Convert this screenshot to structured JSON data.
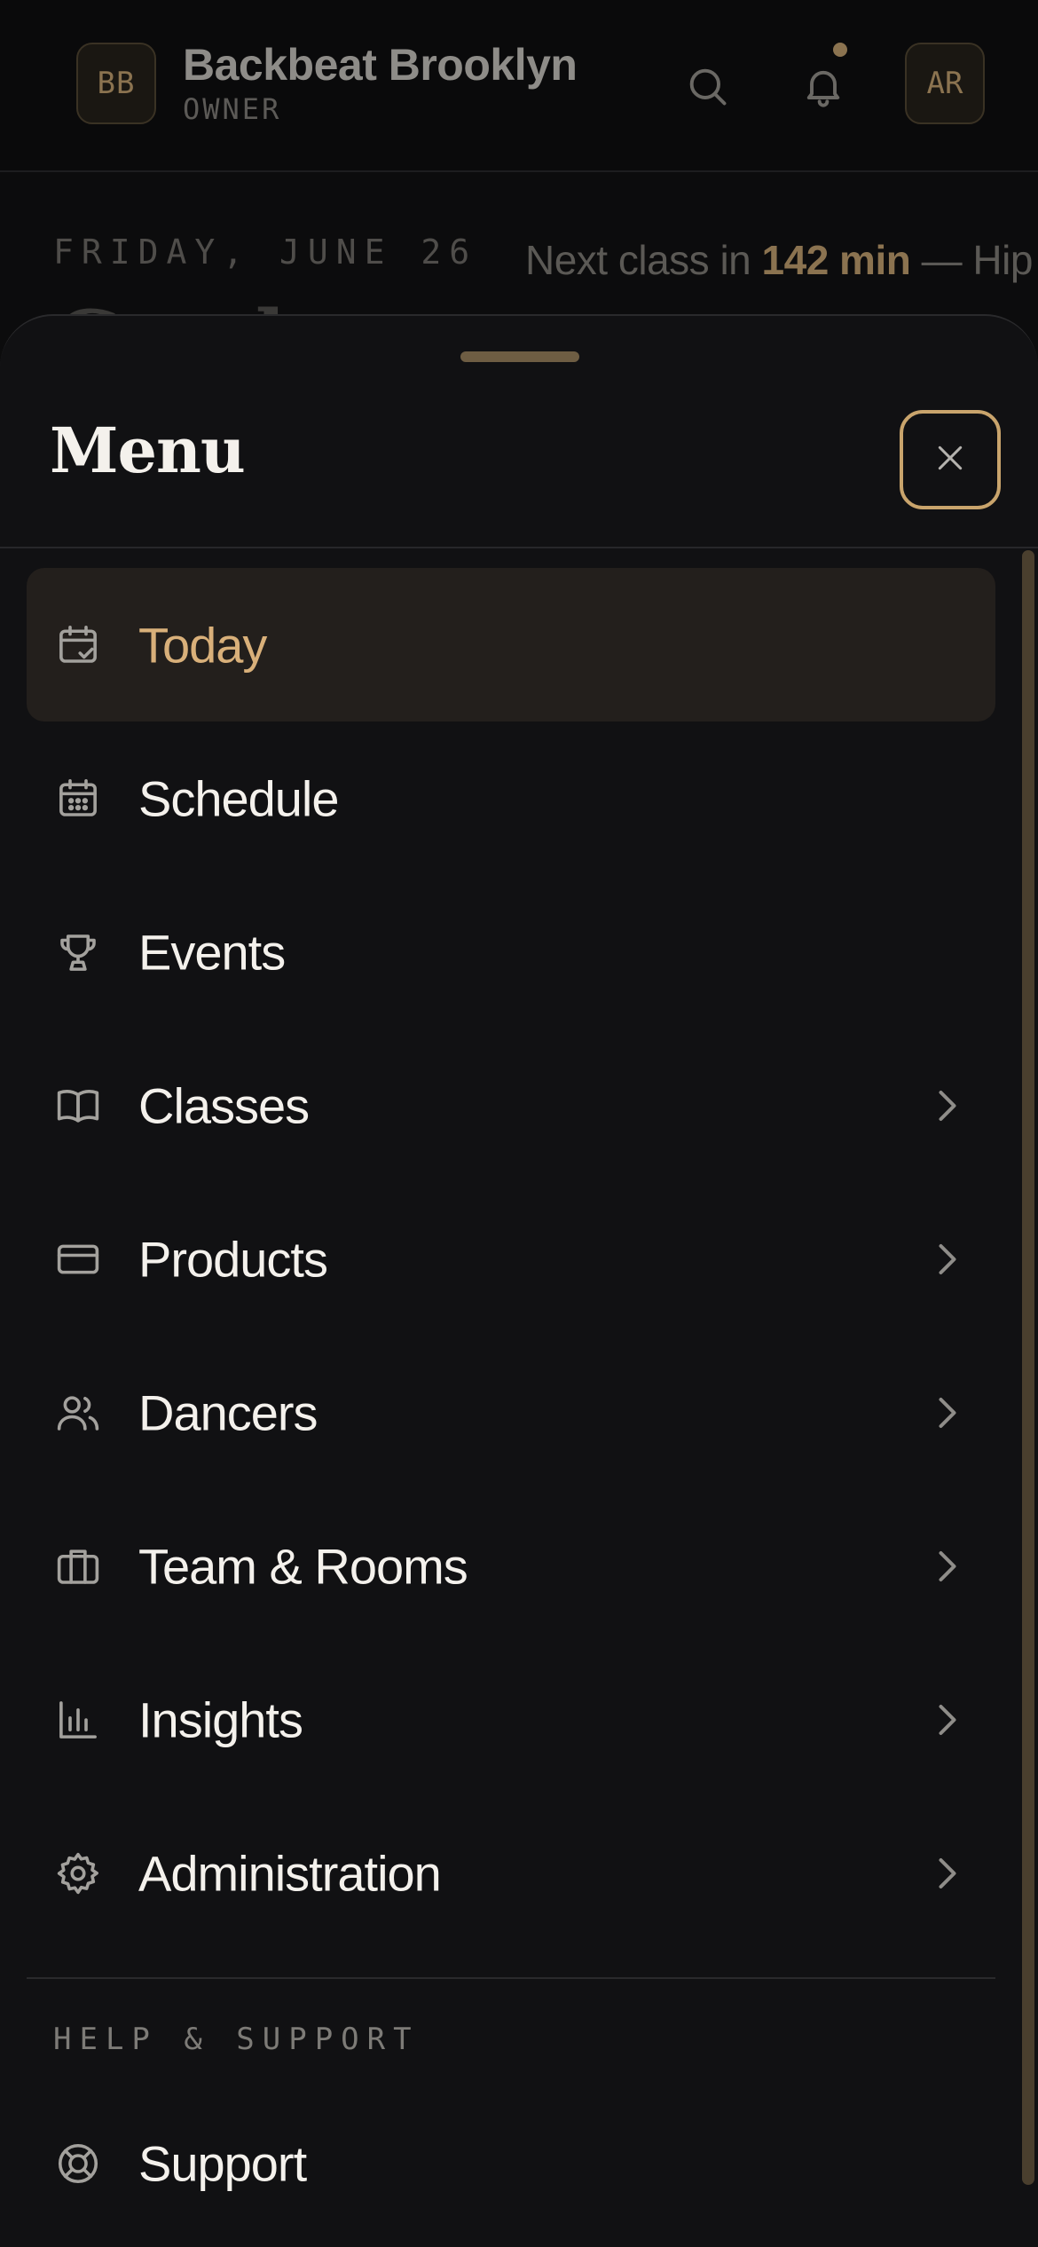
{
  "topbar": {
    "brand_initials": "BB",
    "brand_name": "Backbeat Brooklyn",
    "brand_role": "OWNER",
    "user_initials": "AR",
    "icons": [
      "search-icon",
      "bell-icon"
    ]
  },
  "background": {
    "date": "FRIDAY, JUNE 26",
    "next_class_prefix": "Next class in ",
    "next_class_time": "142 min",
    "next_class_suffix": " — Hip H",
    "heading_partial": "Good"
  },
  "sheet": {
    "title": "Menu",
    "close_icon": "close-icon",
    "items": [
      {
        "label": "Today",
        "icon": "calendar-check-icon",
        "active": true,
        "has_chevron": false
      },
      {
        "label": "Schedule",
        "icon": "calendar-grid-icon",
        "active": false,
        "has_chevron": false
      },
      {
        "label": "Events",
        "icon": "trophy-icon",
        "active": false,
        "has_chevron": false
      },
      {
        "label": "Classes",
        "icon": "book-icon",
        "active": false,
        "has_chevron": true
      },
      {
        "label": "Products",
        "icon": "credit-card-icon",
        "active": false,
        "has_chevron": true
      },
      {
        "label": "Dancers",
        "icon": "users-icon",
        "active": false,
        "has_chevron": true
      },
      {
        "label": "Team & Rooms",
        "icon": "briefcase-icon",
        "active": false,
        "has_chevron": true
      },
      {
        "label": "Insights",
        "icon": "bar-chart-icon",
        "active": false,
        "has_chevron": true
      },
      {
        "label": "Administration",
        "icon": "gear-icon",
        "active": false,
        "has_chevron": true
      }
    ],
    "help_section": {
      "label": "HELP & SUPPORT",
      "items": [
        {
          "label": "Support",
          "icon": "lifebuoy-icon"
        }
      ]
    }
  },
  "colors": {
    "accent": "#d9b07a",
    "accent_border": "#c9a46c",
    "background": "#111113",
    "active_row": "#231f1c",
    "text": "#f4f1ec",
    "icon": "#a3a19d"
  }
}
